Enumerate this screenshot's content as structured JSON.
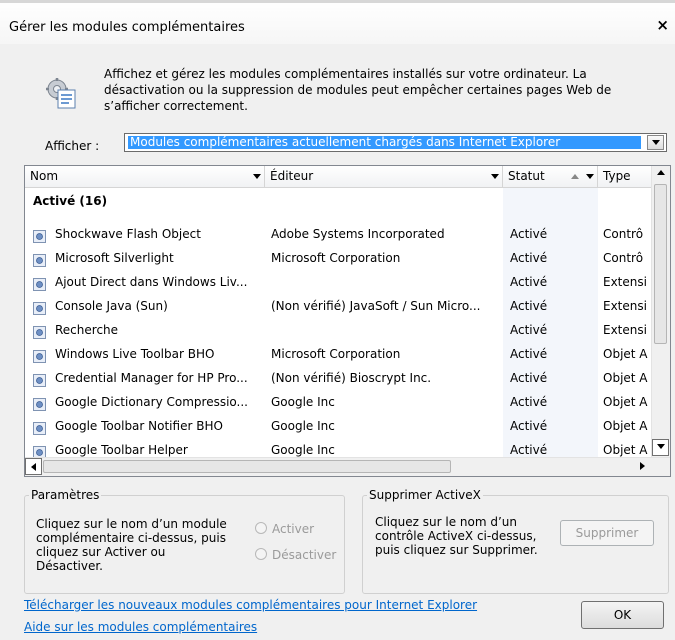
{
  "window": {
    "title": "Gérer les modules complémentaires",
    "close_glyph": "×"
  },
  "header": {
    "icon": "addon-manager-icon",
    "description": "Affichez et gérez les modules complémentaires installés sur votre ordinateur. La désactivation ou la suppression de modules peut empêcher certaines pages Web de s’afficher correctement."
  },
  "show": {
    "label": "Afficher :",
    "selected": "Modules complémentaires actuellement chargés dans Internet Explorer"
  },
  "list": {
    "columns": [
      {
        "label": "Nom"
      },
      {
        "label": "Éditeur"
      },
      {
        "label": "Statut"
      },
      {
        "label": "Type"
      }
    ],
    "group_label": "Activé (16)",
    "rows": [
      {
        "name": "Shockwave Flash Object",
        "publisher": "Adobe Systems Incorporated",
        "status": "Activé",
        "type": "Contrô"
      },
      {
        "name": "Microsoft Silverlight",
        "publisher": "Microsoft Corporation",
        "status": "Activé",
        "type": "Contrô"
      },
      {
        "name": "Ajout Direct dans Windows Liv...",
        "publisher": "",
        "status": "Activé",
        "type": "Extensi"
      },
      {
        "name": "Console Java (Sun)",
        "publisher": "(Non vérifié) JavaSoft / Sun Micro...",
        "status": "Activé",
        "type": "Extensi"
      },
      {
        "name": "Recherche",
        "publisher": "",
        "status": "Activé",
        "type": "Extensi"
      },
      {
        "name": "Windows Live Toolbar BHO",
        "publisher": "Microsoft Corporation",
        "status": "Activé",
        "type": "Objet A"
      },
      {
        "name": "Credential Manager for HP Pro...",
        "publisher": "(Non vérifié) Bioscrypt Inc.",
        "status": "Activé",
        "type": "Objet A"
      },
      {
        "name": "Google Dictionary Compressio...",
        "publisher": "Google Inc",
        "status": "Activé",
        "type": "Objet A"
      },
      {
        "name": "Google Toolbar Notifier BHO",
        "publisher": "Google Inc",
        "status": "Activé",
        "type": "Objet A"
      },
      {
        "name": "Google Toolbar Helper",
        "publisher": "Google Inc",
        "status": "Activé",
        "type": "Objet A"
      }
    ]
  },
  "settings": {
    "legend": "Paramètres",
    "instructions": "Cliquez sur le nom d’un module complémentaire ci-dessus, puis cliquez sur Activer ou Désactiver.",
    "enable_label": "Activer",
    "disable_label": "Désactiver"
  },
  "activex": {
    "legend": "Supprimer ActiveX",
    "instructions": "Cliquez sur le nom d’un contrôle ActiveX ci-dessus, puis cliquez sur Supprimer.",
    "remove_label": "Supprimer"
  },
  "footer": {
    "download_link": "Télécharger les nouveaux modules complémentaires pour Internet Explorer",
    "help_link": "Aide sur les modules complémentaires",
    "ok_label": "OK"
  },
  "colors": {
    "selection": "#3399ff",
    "link": "#0066cc",
    "status_column_bg": "#f3f6fb"
  }
}
